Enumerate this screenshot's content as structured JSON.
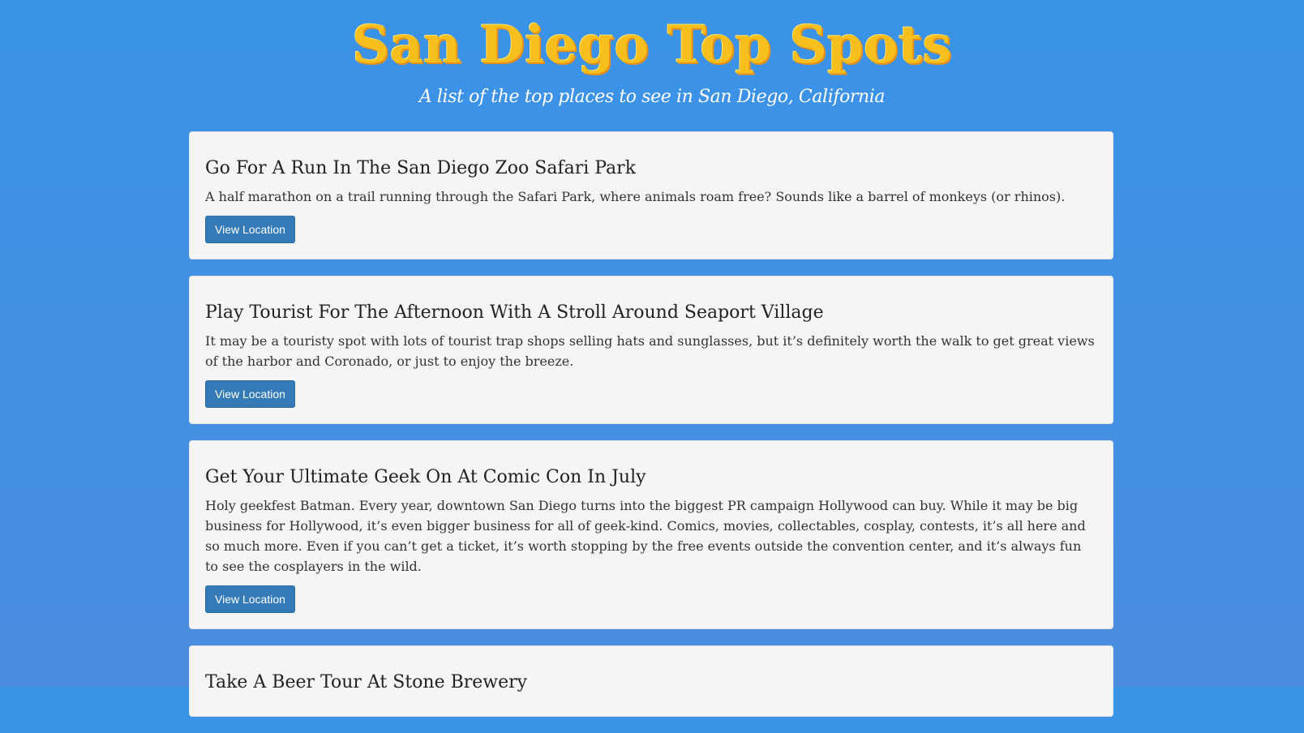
{
  "header": {
    "title": "San Diego Top Spots",
    "subtitle": "A list of the top places to see in San Diego, California"
  },
  "spots": [
    {
      "title": "Go For A Run In The San Diego Zoo Safari Park",
      "description": "A half marathon on a trail running through the Safari Park, where animals roam free? Sounds like a barrel of monkeys (or rhinos).",
      "button_label": "View Location"
    },
    {
      "title": "Play Tourist For The Afternoon With A Stroll Around Seaport Village",
      "description": "It may be a touristy spot with lots of tourist trap shops selling hats and sunglasses, but it’s definitely worth the walk to get great views of the harbor and Coronado, or just to enjoy the breeze.",
      "button_label": "View Location"
    },
    {
      "title": "Get Your Ultimate Geek On At Comic Con In July",
      "description": "Holy geekfest Batman. Every year, downtown San Diego turns into the biggest PR campaign Hollywood can buy. While it may be big business for Hollywood, it’s even bigger business for all of geek-kind. Comics, movies, collectables, cosplay, contests, it’s all here and so much more. Even if you can’t get a ticket, it’s worth stopping by the free events outside the convention center, and it’s always fun to see the cosplayers in the wild.",
      "button_label": "View Location"
    },
    {
      "title": "Take A Beer Tour At Stone Brewery"
    }
  ],
  "colors": {
    "background": "#3a93e7",
    "title": "#f6bf1d",
    "card": "#f5f5f5",
    "button": "#337ab7"
  }
}
